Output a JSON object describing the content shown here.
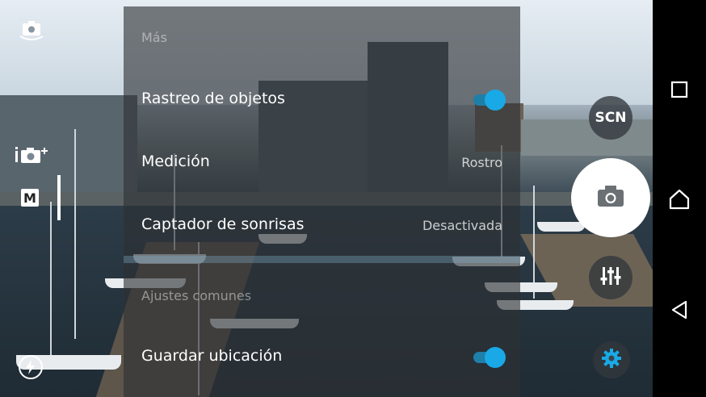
{
  "settings_panel": {
    "section_more": "Más",
    "rows": [
      {
        "label": "Rastreo de objetos",
        "toggle_on": true
      },
      {
        "label": "Medición",
        "value": "Rostro"
      },
      {
        "label": "Captador de sonrisas",
        "value": "Desactivada"
      }
    ],
    "section_common": "Ajustes comunes",
    "common_rows": [
      {
        "label": "Guardar ubicación",
        "toggle_on": true
      }
    ]
  },
  "left_controls": {
    "mode_label": "M"
  },
  "right_controls": {
    "scene_label": "SCN"
  },
  "colors": {
    "accent": "#19a9e6",
    "panel": "#2d3034",
    "navbar": "#000000"
  },
  "icons": [
    "switch-camera-icon",
    "add-camera-app-icon",
    "manual-mode-icon",
    "flash-auto-icon",
    "camera-icon",
    "sliders-icon",
    "gear-icon",
    "recents-icon",
    "home-icon",
    "back-icon"
  ]
}
